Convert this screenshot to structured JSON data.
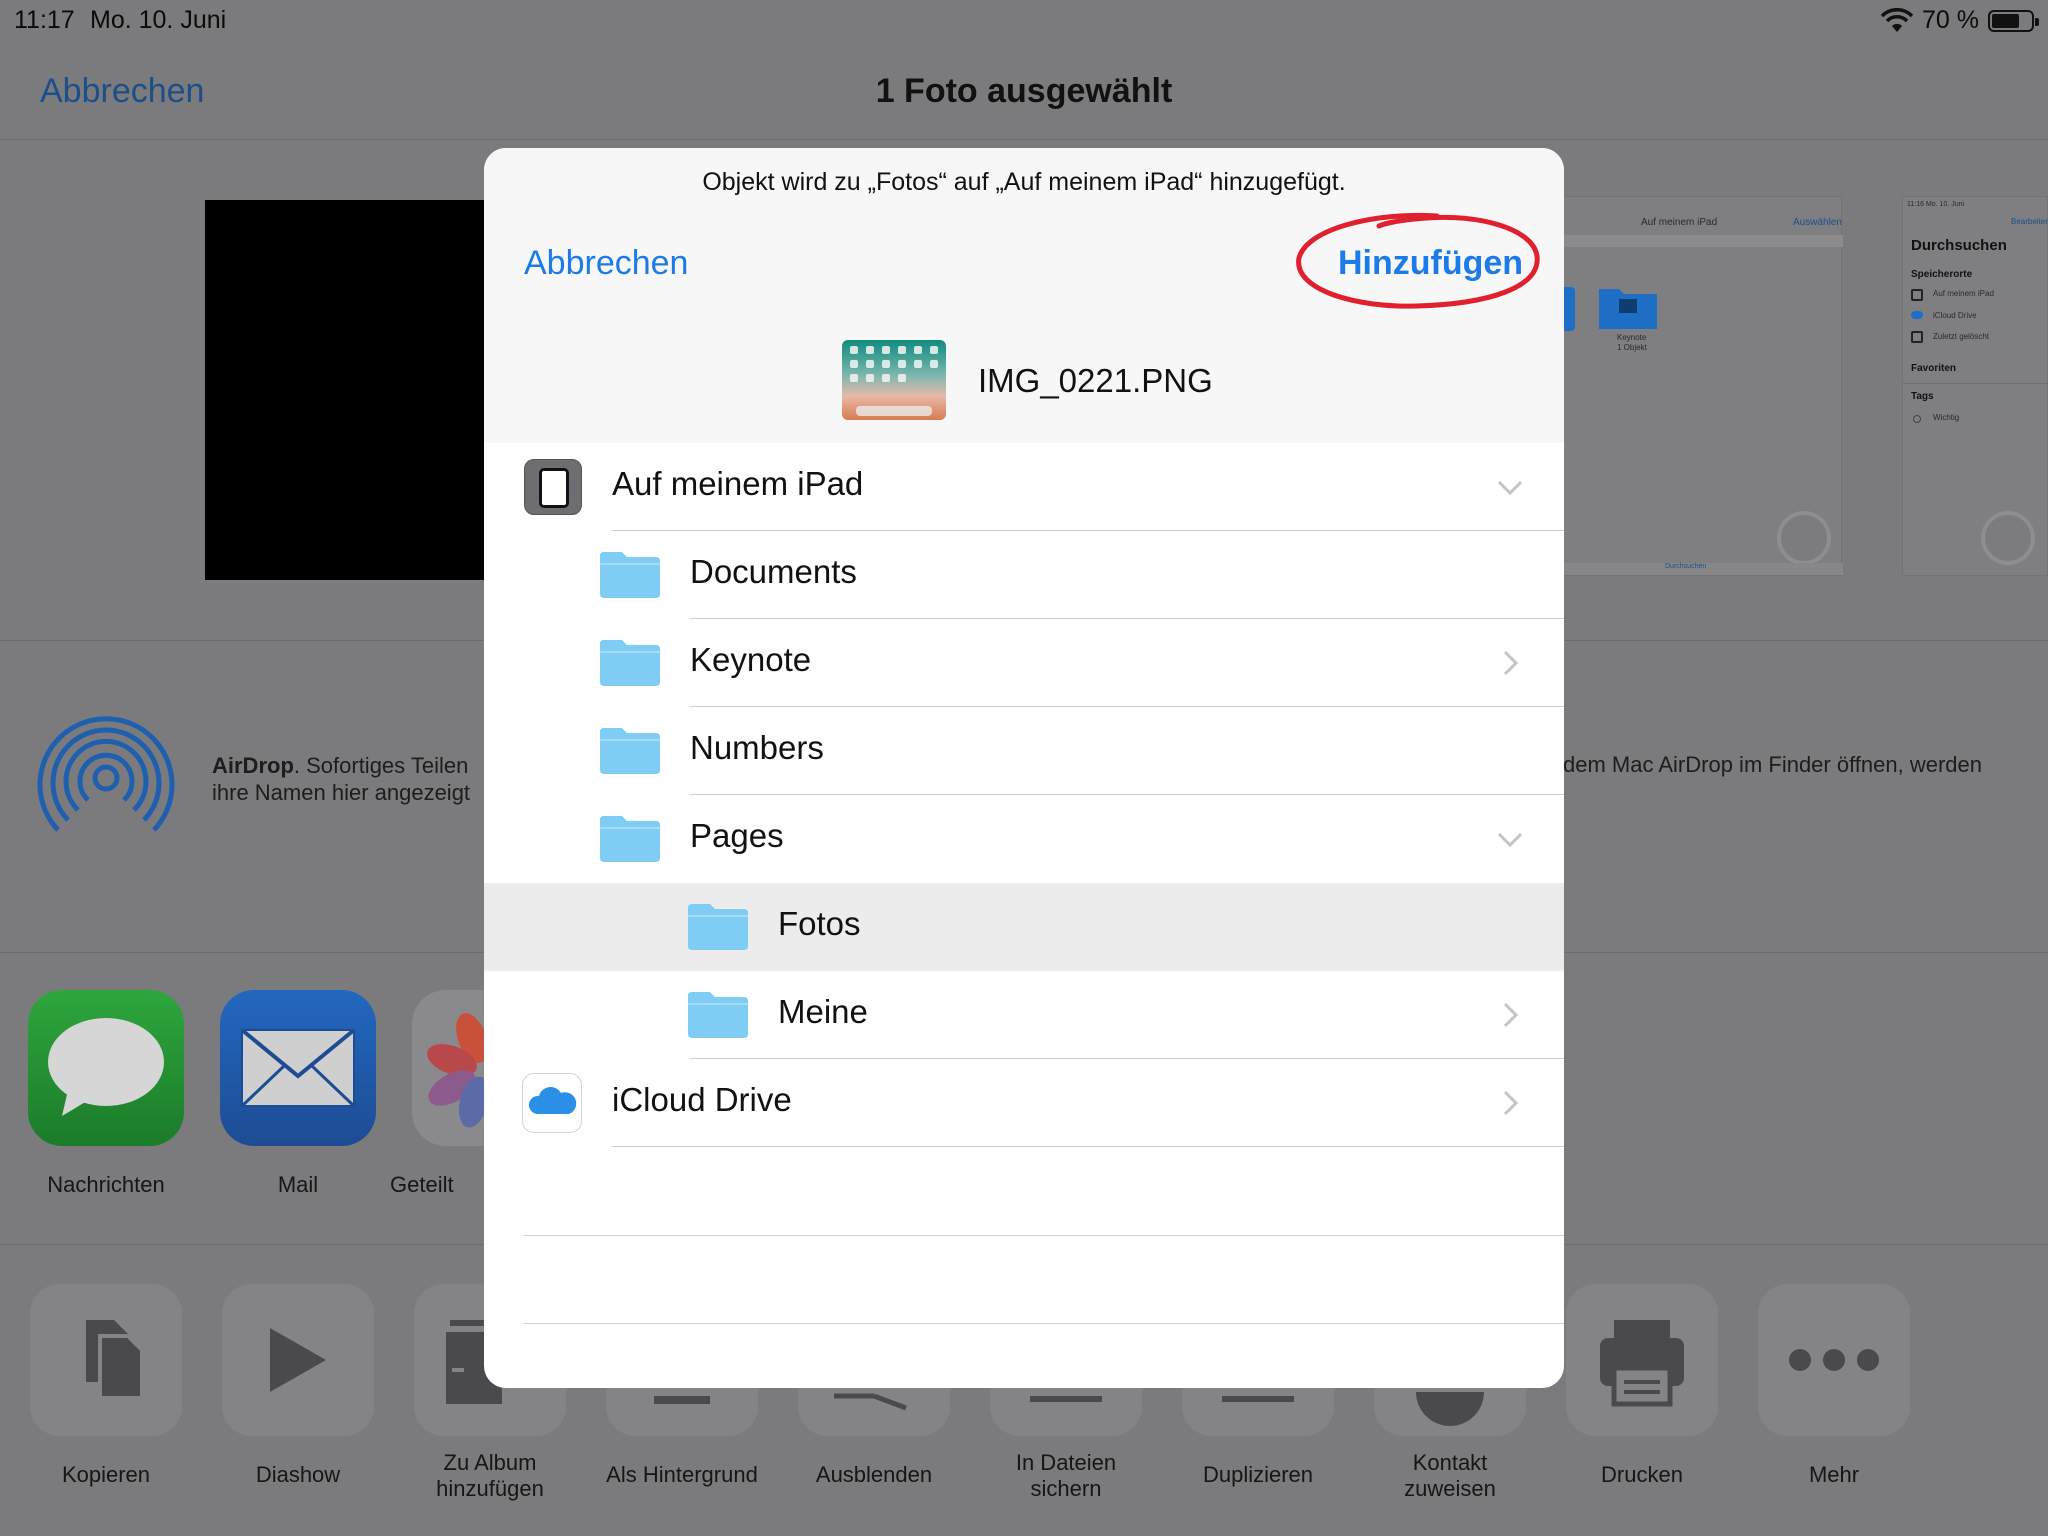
{
  "status": {
    "time": "11:17",
    "date": "Mo. 10. Juni",
    "battery_pct": "70 %"
  },
  "header": {
    "cancel": "Abbrechen",
    "title": "1 Foto ausgewählt"
  },
  "previews": {
    "p1_title": "Auf meinem iPad",
    "p1_action": "Auswählen",
    "p1_folder": "Keynote",
    "p1_folder_sub": "1 Objekt",
    "p1_bottom": "Durchsuchen",
    "p2_date": "11:16   Mo. 10. Juni",
    "p2_action": "Bearbeiten",
    "browse": "Durchsuchen",
    "locations": "Speicherorte",
    "loc1": "Auf meinem iPad",
    "loc2": "iCloud Drive",
    "loc3": "Zuletzt gelöscht",
    "favorites": "Favoriten",
    "tags": "Tags",
    "tag1": "Wichtig"
  },
  "airdrop": {
    "bold": "AirDrop",
    "text1": ". Sofortiges Teilen",
    "text2": "ihre Namen hier angezeigt",
    "right": "dem Mac AirDrop im Finder öffnen, werden"
  },
  "apps": [
    {
      "label": "Nachrichten"
    },
    {
      "label": "Mail"
    },
    {
      "label": "Geteilt"
    }
  ],
  "actions": [
    {
      "label": "Kopieren"
    },
    {
      "label": "Diashow"
    },
    {
      "label": "Zu Album\nhinzufügen"
    },
    {
      "label": "Als Hintergrund"
    },
    {
      "label": "Ausblenden"
    },
    {
      "label": "In Dateien\nsichern"
    },
    {
      "label": "Duplizieren"
    },
    {
      "label": "Kontakt\nzuweisen"
    },
    {
      "label": "Drucken"
    },
    {
      "label": "Mehr"
    }
  ],
  "modal": {
    "message": "Objekt wird zu „Fotos“ auf „Auf meinem iPad“ hinzugefügt.",
    "cancel": "Abbrechen",
    "add": "Hinzufügen",
    "file_name": "IMG_0221.PNG",
    "rows": [
      {
        "label": "Auf meinem iPad"
      },
      {
        "label": "Documents"
      },
      {
        "label": "Keynote"
      },
      {
        "label": "Numbers"
      },
      {
        "label": "Pages"
      },
      {
        "label": "Fotos"
      },
      {
        "label": "Meine"
      },
      {
        "label": "iCloud Drive"
      }
    ]
  },
  "colors": {
    "accent": "#1c7be8",
    "annotation": "#e0202e",
    "folder": "#7fcdf5"
  }
}
